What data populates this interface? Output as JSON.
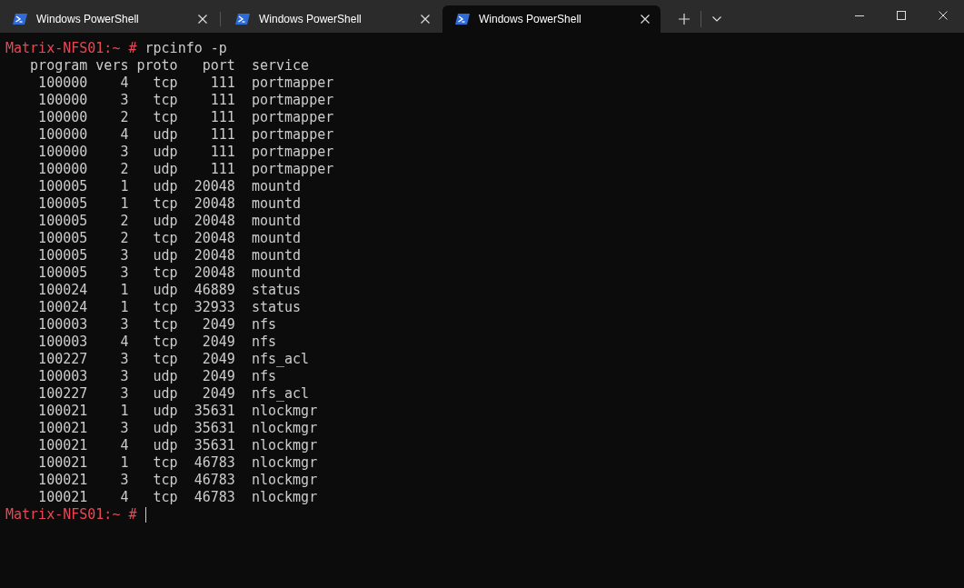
{
  "tabs": [
    {
      "title": "Windows PowerShell",
      "selected": false
    },
    {
      "title": "Windows PowerShell",
      "selected": false
    },
    {
      "title": "Windows PowerShell",
      "selected": true
    }
  ],
  "terminal": {
    "lines": [
      {
        "kind": "prompt",
        "prompt": "Matrix-NFS01:~ #",
        "command": "rpcinfo -p"
      },
      {
        "kind": "output",
        "text": "   program vers proto   port  service"
      },
      {
        "kind": "output",
        "text": "    100000    4   tcp    111  portmapper"
      },
      {
        "kind": "output",
        "text": "    100000    3   tcp    111  portmapper"
      },
      {
        "kind": "output",
        "text": "    100000    2   tcp    111  portmapper"
      },
      {
        "kind": "output",
        "text": "    100000    4   udp    111  portmapper"
      },
      {
        "kind": "output",
        "text": "    100000    3   udp    111  portmapper"
      },
      {
        "kind": "output",
        "text": "    100000    2   udp    111  portmapper"
      },
      {
        "kind": "output",
        "text": "    100005    1   udp  20048  mountd"
      },
      {
        "kind": "output",
        "text": "    100005    1   tcp  20048  mountd"
      },
      {
        "kind": "output",
        "text": "    100005    2   udp  20048  mountd"
      },
      {
        "kind": "output",
        "text": "    100005    2   tcp  20048  mountd"
      },
      {
        "kind": "output",
        "text": "    100005    3   udp  20048  mountd"
      },
      {
        "kind": "output",
        "text": "    100005    3   tcp  20048  mountd"
      },
      {
        "kind": "output",
        "text": "    100024    1   udp  46889  status"
      },
      {
        "kind": "output",
        "text": "    100024    1   tcp  32933  status"
      },
      {
        "kind": "output",
        "text": "    100003    3   tcp   2049  nfs"
      },
      {
        "kind": "output",
        "text": "    100003    4   tcp   2049  nfs"
      },
      {
        "kind": "output",
        "text": "    100227    3   tcp   2049  nfs_acl"
      },
      {
        "kind": "output",
        "text": "    100003    3   udp   2049  nfs"
      },
      {
        "kind": "output",
        "text": "    100227    3   udp   2049  nfs_acl"
      },
      {
        "kind": "output",
        "text": "    100021    1   udp  35631  nlockmgr"
      },
      {
        "kind": "output",
        "text": "    100021    3   udp  35631  nlockmgr"
      },
      {
        "kind": "output",
        "text": "    100021    4   udp  35631  nlockmgr"
      },
      {
        "kind": "output",
        "text": "    100021    1   tcp  46783  nlockmgr"
      },
      {
        "kind": "output",
        "text": "    100021    3   tcp  46783  nlockmgr"
      },
      {
        "kind": "output",
        "text": "    100021    4   tcp  46783  nlockmgr"
      },
      {
        "kind": "prompt",
        "prompt": "Matrix-NFS01:~ #",
        "cursor": true
      }
    ]
  }
}
